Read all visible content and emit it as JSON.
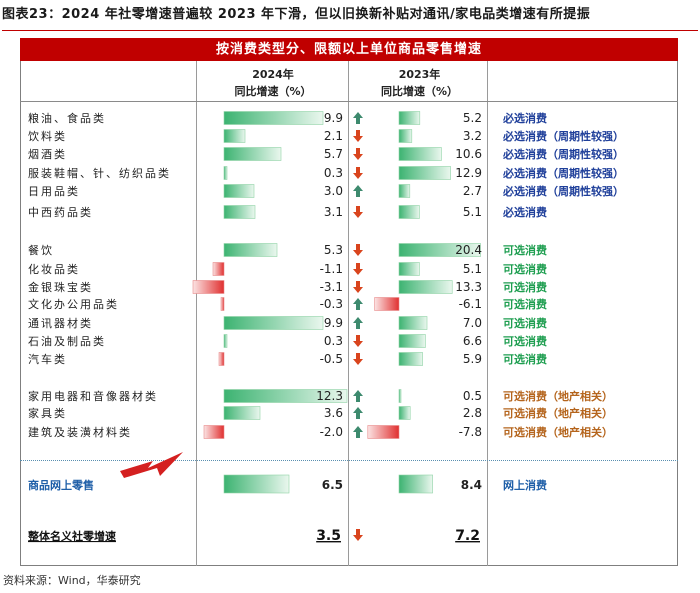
{
  "page_title": "图表23：2024 年社零增速普遍较 2023 年下滑，但以旧换新补贴对通讯/家电品类增速有所提振",
  "table_title": "按消费类型分、限额以上单位商品零售增速",
  "col_2024_header": "2024年\n同比增速（%）",
  "col_2023_header": "2023年\n同比增速（%）",
  "source": "资料来源：Wind，华泰研究",
  "colors": {
    "banner": "#c00000",
    "bar_pos": "#3cb371",
    "bar_neg": "#e03030",
    "tag_blue": "#1f3f9a",
    "tag_green": "#1e9e50",
    "tag_brown": "#b5651d",
    "arrow_up": "#3d8a6e",
    "arrow_down": "#d9441d"
  },
  "chart_data": {
    "type": "table",
    "title": "按消费类型分、限额以上单位商品零售增速",
    "columns": [
      "2024年同比增速（%）",
      "2023年同比增速（%）"
    ],
    "rows": [
      {
        "label": "粮油、食品类",
        "v2024": 9.9,
        "trend": "up",
        "v2023": 5.2,
        "tag": "必选消费",
        "tag_color": "blue"
      },
      {
        "label": "饮料类",
        "v2024": 2.1,
        "trend": "down",
        "v2023": 3.2,
        "tag": "必选消费（周期性较强）",
        "tag_color": "blue"
      },
      {
        "label": "烟酒类",
        "v2024": 5.7,
        "trend": "down",
        "v2023": 10.6,
        "tag": "必选消费（周期性较强）",
        "tag_color": "blue"
      },
      {
        "label": "服装鞋帽、针、纺织品类",
        "v2024": 0.3,
        "trend": "down",
        "v2023": 12.9,
        "tag": "必选消费（周期性较强）",
        "tag_color": "blue"
      },
      {
        "label": "日用品类",
        "v2024": 3.0,
        "trend": "up",
        "v2023": 2.7,
        "tag": "必选消费（周期性较强）",
        "tag_color": "blue"
      },
      {
        "label": "中西药品类",
        "v2024": 3.1,
        "trend": "down",
        "v2023": 5.1,
        "tag": "必选消费",
        "tag_color": "blue"
      },
      {
        "label": "餐饮",
        "v2024": 5.3,
        "trend": "down",
        "v2023": 20.4,
        "tag": "可选消费",
        "tag_color": "green"
      },
      {
        "label": "化妆品类",
        "v2024": -1.1,
        "trend": "down",
        "v2023": 5.1,
        "tag": "可选消费",
        "tag_color": "green"
      },
      {
        "label": "金银珠宝类",
        "v2024": -3.1,
        "trend": "down",
        "v2023": 13.3,
        "tag": "可选消费",
        "tag_color": "green"
      },
      {
        "label": "文化办公用品类",
        "v2024": -0.3,
        "trend": "up",
        "v2023": -6.1,
        "tag": "可选消费",
        "tag_color": "green"
      },
      {
        "label": "通讯器材类",
        "v2024": 9.9,
        "trend": "up",
        "v2023": 7.0,
        "tag": "可选消费",
        "tag_color": "green"
      },
      {
        "label": "石油及制品类",
        "v2024": 0.3,
        "trend": "down",
        "v2023": 6.6,
        "tag": "可选消费",
        "tag_color": "green"
      },
      {
        "label": "汽车类",
        "v2024": -0.5,
        "trend": "down",
        "v2023": 5.9,
        "tag": "可选消费",
        "tag_color": "green"
      },
      {
        "label": "家用电器和音像器材类",
        "v2024": 12.3,
        "trend": "up",
        "v2023": 0.5,
        "tag": "可选消费（地产相关）",
        "tag_color": "brown"
      },
      {
        "label": "家具类",
        "v2024": 3.6,
        "trend": "up",
        "v2023": 2.8,
        "tag": "可选消费（地产相关）",
        "tag_color": "brown"
      },
      {
        "label": "建筑及装潢材料类",
        "v2024": -2.0,
        "trend": "up",
        "v2023": -7.8,
        "tag": "可选消费（地产相关）",
        "tag_color": "brown"
      }
    ],
    "online": {
      "label": "商品网上零售",
      "v2024": 6.5,
      "v2023": 8.4,
      "tag": "网上消费"
    },
    "total": {
      "label": "整体名义社零增速",
      "v2024": 3.5,
      "trend": "down",
      "v2023": 7.2
    }
  }
}
